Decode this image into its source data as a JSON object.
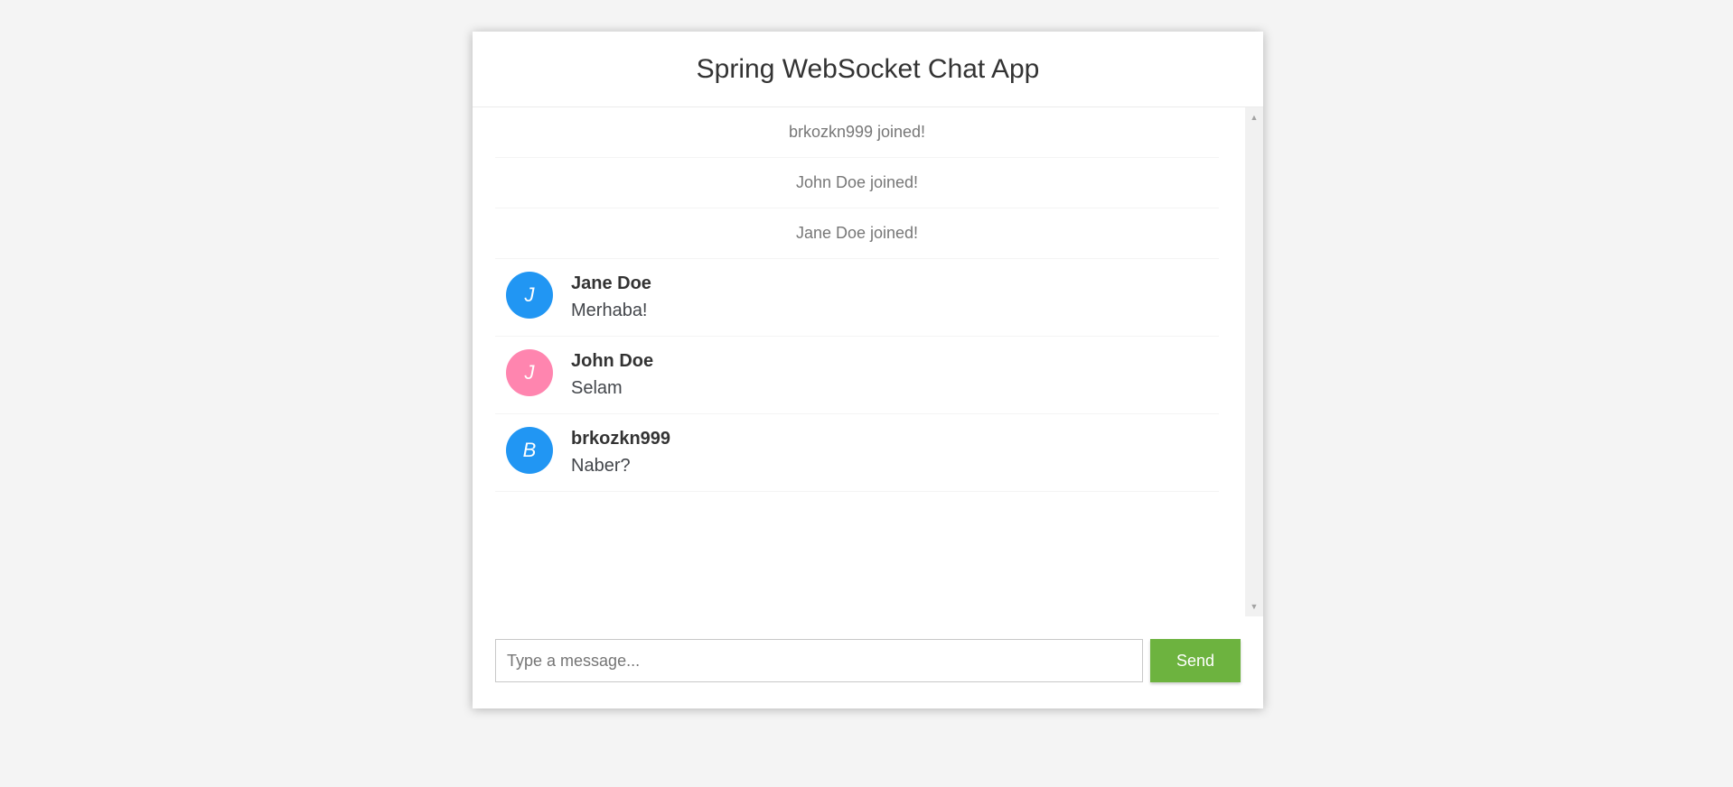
{
  "header": {
    "title": "Spring WebSocket Chat App"
  },
  "colors": {
    "accent_send": "#6db33f",
    "avatar_blue": "#2196f3",
    "avatar_pink": "#ff85af"
  },
  "events": [
    {
      "text": "brkozkn999 joined!"
    },
    {
      "text": "John Doe joined!"
    },
    {
      "text": "Jane Doe joined!"
    }
  ],
  "messages": [
    {
      "initial": "J",
      "sender": "Jane Doe",
      "text": "Merhaba!",
      "avatar_color": "#2196f3"
    },
    {
      "initial": "J",
      "sender": "John Doe",
      "text": "Selam",
      "avatar_color": "#ff85af"
    },
    {
      "initial": "B",
      "sender": "brkozkn999",
      "text": "Naber?",
      "avatar_color": "#2196f3"
    }
  ],
  "composer": {
    "placeholder": "Type a message...",
    "value": "",
    "send_label": "Send"
  },
  "scrollbar": {
    "up_icon": "triangle-up",
    "down_icon": "triangle-down"
  }
}
